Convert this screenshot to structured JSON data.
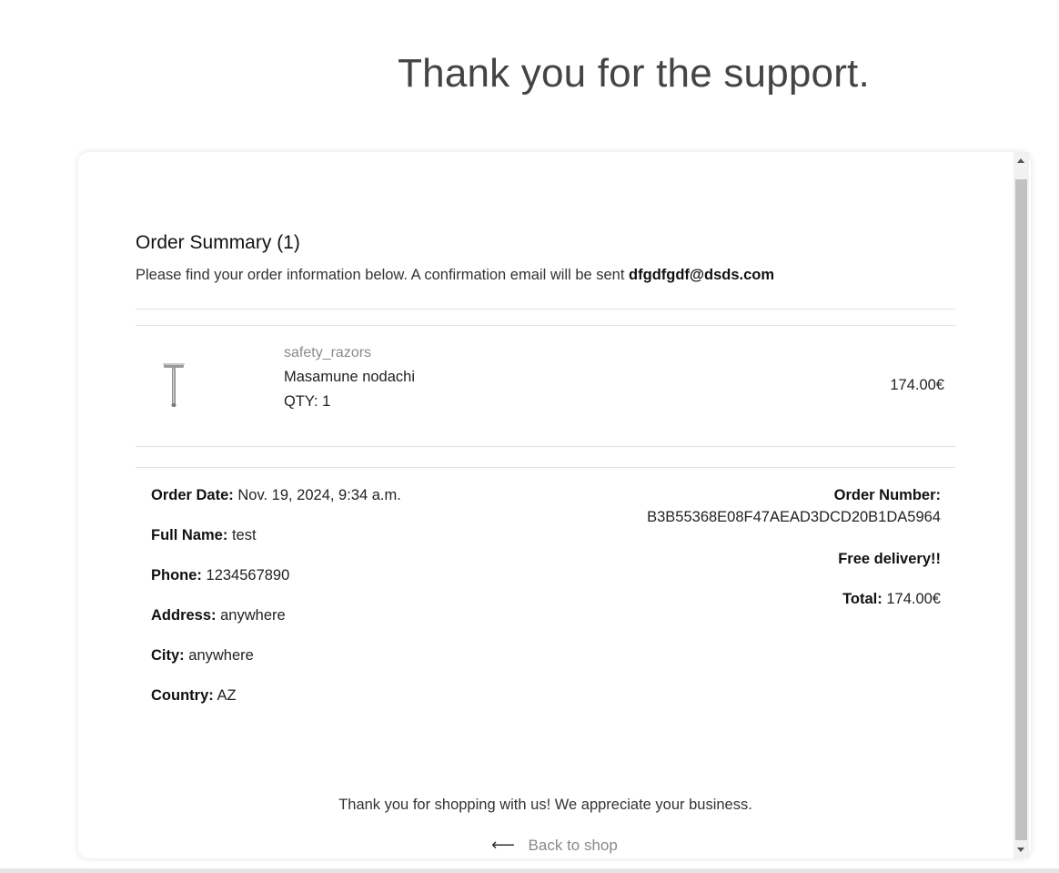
{
  "page": {
    "title": "Thank you for the support."
  },
  "summary": {
    "title": "Order Summary (1)",
    "subtitle": "Please find your order information below. A confirmation email will be sent",
    "email": "dfgdfgdf@dsds.com"
  },
  "items": [
    {
      "category": "safety_razors",
      "name": "Masamune nodachi",
      "qty": "QTY: 1",
      "price": "174.00€",
      "icon": "razor-icon"
    }
  ],
  "details": {
    "order_date_label": "Order Date:",
    "order_date": "Nov. 19, 2024, 9:34 a.m.",
    "full_name_label": "Full Name:",
    "full_name": "test",
    "phone_label": "Phone:",
    "phone": "1234567890",
    "address_label": "Address:",
    "address": "anywhere",
    "city_label": "City:",
    "city": "anywhere",
    "country_label": "Country:",
    "country": "AZ"
  },
  "order": {
    "number_label": "Order Number:",
    "number": "B3B55368E08F47AEAD3DCD20B1DA5964",
    "delivery": "Free delivery!!",
    "total_label": "Total:",
    "total": "174.00€"
  },
  "footer": {
    "thanks": "Thank you for shopping with us! We appreciate your business.",
    "back_arrow": "⟵",
    "back_label": "Back to shop"
  }
}
